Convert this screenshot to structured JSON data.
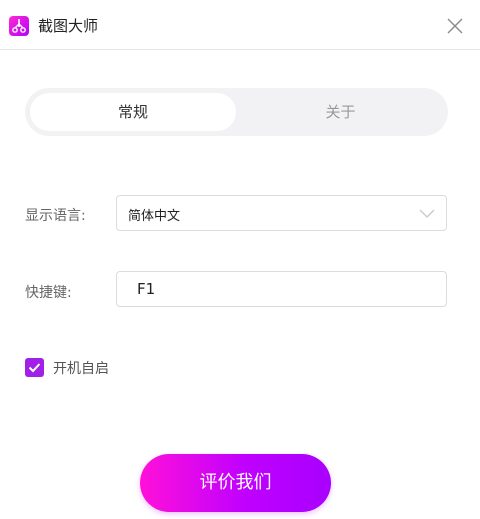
{
  "window": {
    "title": "截图大师"
  },
  "tabs": [
    {
      "label": "常规",
      "active": true
    },
    {
      "label": "关于",
      "active": false
    }
  ],
  "settings": {
    "language_label": "显示语言:",
    "language_value": "简体中文",
    "hotkey_label": "快捷键:",
    "hotkey_value": "F1",
    "autostart_label": "开机自启",
    "autostart_checked": true
  },
  "actions": {
    "rate_label": "评价我们"
  },
  "colors": {
    "accent": "#a020e8",
    "gradient_start": "#ff10d8",
    "gradient_end": "#a800ff"
  },
  "icons": {
    "app": "scissors-icon",
    "close": "close-icon",
    "dropdown": "chevron-down-icon",
    "check": "check-icon"
  }
}
